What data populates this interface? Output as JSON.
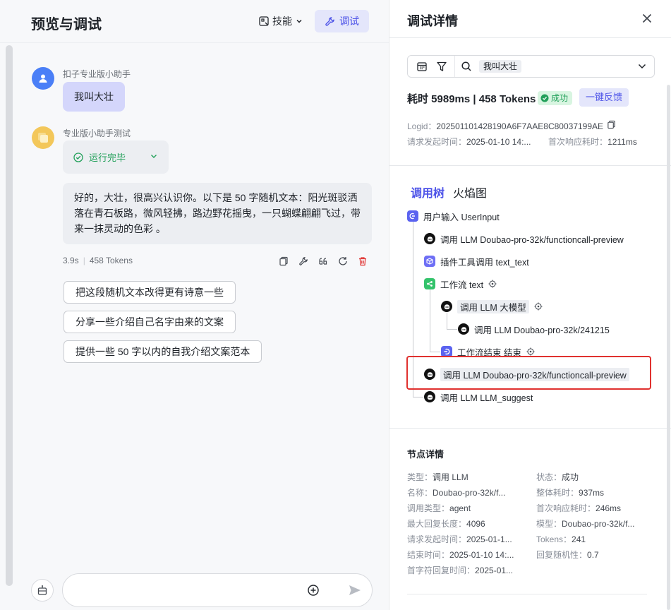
{
  "left": {
    "title": "预览与调试",
    "skill_label": "技能",
    "debug_label": "调试"
  },
  "chat": {
    "user_name": "扣子专业版小助手",
    "user_message": "我叫大壮",
    "bot_name": "专业版小助手测试",
    "run_status": "运行完毕",
    "answer": "好的，大壮，很高兴认识你。以下是 50 字随机文本：阳光斑驳洒落在青石板路，微风轻拂，路边野花摇曳，一只蝴蝶翩翩飞过，带来一抹灵动的色彩 。",
    "duration": "3.9s",
    "tokens": "458 Tokens",
    "suggestions": [
      "把这段随机文本改得更有诗意一些",
      "分享一些介绍自己名字由来的文案",
      "提供一些 50 字以内的自我介绍文案范本"
    ],
    "input_placeholder": ""
  },
  "detail": {
    "title": "调试详情",
    "search_tag": "我叫大壮",
    "cost_summary": "耗时 5989ms | 458 Tokens",
    "status_badge": "成功",
    "feedback_label": "一键反馈",
    "logid_label": "Logid：",
    "logid_value": "202501101428190A6F7AAE8C80037199AE",
    "request_time_label": "请求发起时间：",
    "request_time_value": "2025-01-10 14:...",
    "first_resp_label": "首次响应耗时：",
    "first_resp_value": "1211ms",
    "tabs": [
      "调用树",
      "火焰图"
    ],
    "tree": [
      {
        "label": "用户输入 UserInput",
        "icon": "user-input-icon"
      },
      {
        "label": "调用 LLM Doubao-pro-32k/functioncall-preview",
        "icon": "llm-icon"
      },
      {
        "label": "插件工具调用 text_text",
        "icon": "plugin-icon"
      },
      {
        "label": "工作流 text",
        "icon": "workflow-icon"
      },
      {
        "label": "调用 LLM 大模型",
        "icon": "llm-icon"
      },
      {
        "label": "调用 LLM Doubao-pro-32k/241215",
        "icon": "llm-icon"
      },
      {
        "label": "工作流结束 结束",
        "icon": "workflow-end-icon"
      },
      {
        "label": "调用 LLM Doubao-pro-32k/functioncall-preview",
        "icon": "llm-icon"
      },
      {
        "label": "调用 LLM LLM_suggest",
        "icon": "llm-icon"
      }
    ],
    "node_detail_title": "节点详情",
    "node_detail": {
      "type_label": "类型：",
      "type_value": "调用 LLM",
      "status_label": "状态：",
      "status_value": "成功",
      "name_label": "名称：",
      "name_value": "Doubao-pro-32k/f...",
      "total_label": "整体耗时：",
      "total_value": "937ms",
      "calltype_label": "调用类型：",
      "calltype_value": "agent",
      "firstresp_label": "首次响应耗时：",
      "firstresp_value": "246ms",
      "maxlen_label": "最大回复长度：",
      "maxlen_value": "4096",
      "model_label": "模型：",
      "model_value": "Doubao-pro-32k/f...",
      "reqtime_label": "请求发起时间：",
      "reqtime_value": "2025-01-1...",
      "tokens_label": "Tokens：",
      "tokens_value": "241",
      "endtime_label": "结束时间：",
      "endtime_value": "2025-01-10 14:...",
      "random_label": "回复随机性：",
      "random_value": "0.7",
      "firstchar_label": "首字符回复时间：",
      "firstchar_value": "2025-01..."
    }
  },
  "colors": {
    "accent": "#4d53e8",
    "success": "#22a05a",
    "highlight_border": "#e0312f"
  }
}
